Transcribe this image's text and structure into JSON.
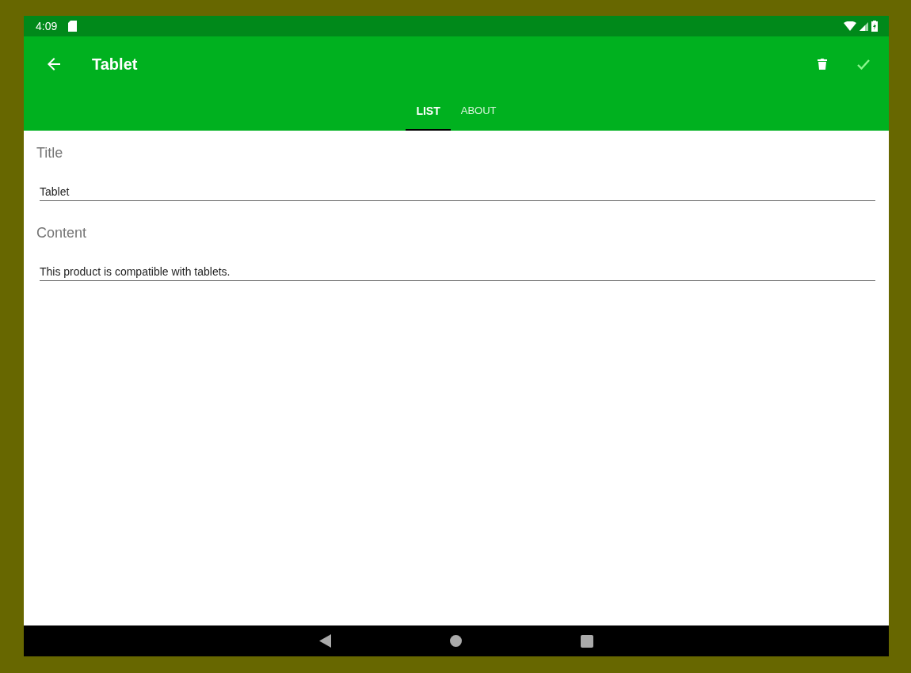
{
  "status_bar": {
    "time": "4:09"
  },
  "toolbar": {
    "title": "Tablet"
  },
  "tabs": [
    {
      "label": "LIST",
      "selected": true
    },
    {
      "label": "ABOUT",
      "selected": false
    }
  ],
  "fields": [
    {
      "label": "Title",
      "value": "Tablet"
    },
    {
      "label": "Content",
      "value": "This product is compatible with tablets."
    }
  ]
}
